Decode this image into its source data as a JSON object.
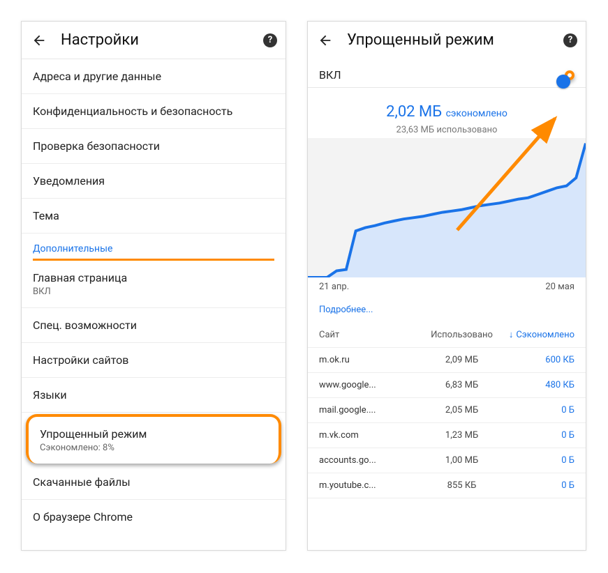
{
  "left": {
    "title": "Настройки",
    "rows": [
      {
        "label": "Адреса и другие данные"
      },
      {
        "label": "Конфиденциальность и безопасность"
      },
      {
        "label": "Проверка безопасности"
      },
      {
        "label": "Уведомления"
      },
      {
        "label": "Тема"
      }
    ],
    "section_label": "Дополнительные",
    "rows2": [
      {
        "label": "Главная страница",
        "sub": "ВКЛ"
      },
      {
        "label": "Спец. возможности"
      },
      {
        "label": "Настройки сайтов"
      },
      {
        "label": "Языки"
      }
    ],
    "lite_mode": {
      "label": "Упрощенный режим",
      "sub": "Сэкономлено: 8%"
    },
    "rows3": [
      {
        "label": "Скачанные файлы"
      },
      {
        "label": "О браузере Chrome"
      }
    ]
  },
  "right": {
    "title": "Упрощенный режим",
    "status": "ВКЛ",
    "saved_value": "2,02 МБ",
    "saved_label": "сэкономлено",
    "used_line": "23,63 МБ использовано",
    "x_start": "21 апр.",
    "x_end": "20 мая",
    "more": "Подробнее...",
    "columns": {
      "site": "Сайт",
      "used": "Использовано",
      "saved": "Сэкономлено"
    },
    "table": [
      {
        "site": "m.ok.ru",
        "used": "2,09 МБ",
        "saved": "600 КБ"
      },
      {
        "site": "www.google...",
        "used": "6,83 МБ",
        "saved": "480 КБ"
      },
      {
        "site": "mail.google....",
        "used": "2,05 МБ",
        "saved": "0 Б"
      },
      {
        "site": "m.vk.com",
        "used": "1,23 МБ",
        "saved": "0 Б"
      },
      {
        "site": "accounts.go...",
        "used": "1,00 МБ",
        "saved": "0 Б"
      },
      {
        "site": "m.youtube.c...",
        "used": "855 КБ",
        "saved": "0 Б"
      }
    ]
  },
  "chart_data": {
    "type": "area",
    "x_range": [
      "21 апр.",
      "20 мая"
    ],
    "title": "",
    "xlabel": "",
    "ylabel": "",
    "series": [
      {
        "name": "сэкономлено",
        "x": [
          0,
          1,
          2,
          3,
          4,
          5,
          6,
          7,
          8,
          9,
          10,
          11,
          12,
          13,
          14,
          15,
          16,
          17,
          18,
          19,
          20,
          21,
          22,
          23,
          24,
          25,
          26,
          27,
          28,
          29
        ],
        "y": [
          0,
          0,
          0,
          0.1,
          0.12,
          0.7,
          0.75,
          0.78,
          0.82,
          0.85,
          0.88,
          0.9,
          0.92,
          0.95,
          0.98,
          1.0,
          1.02,
          1.05,
          1.08,
          1.1,
          1.12,
          1.15,
          1.18,
          1.2,
          1.25,
          1.3,
          1.35,
          1.38,
          1.5,
          2.02
        ]
      }
    ],
    "ylim": [
      0,
      2.1
    ]
  }
}
